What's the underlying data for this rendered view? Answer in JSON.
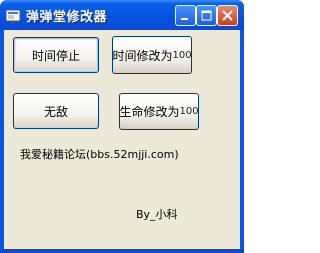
{
  "window": {
    "title": "弹弹堂修改器"
  },
  "buttons": {
    "time_stop": "时间停止",
    "time_modify_prefix": "时间修改为",
    "time_modify_value": "100",
    "invincible": "无敌",
    "life_modify_prefix": "生命修改为",
    "life_modify_value": "100"
  },
  "labels": {
    "forum": "我爱秘籍论坛(bbs.52mjji.com)",
    "author": "By_小科"
  },
  "icons": {
    "app": "app-icon",
    "minimize": "minimize-icon",
    "maximize": "maximize-icon",
    "close": "close-icon"
  }
}
